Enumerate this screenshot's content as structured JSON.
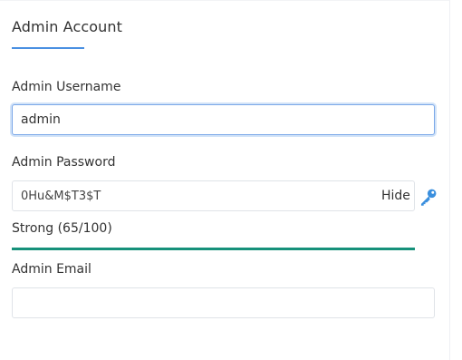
{
  "section": {
    "title": "Admin Account"
  },
  "username": {
    "label": "Admin Username",
    "value": "admin",
    "placeholder": ""
  },
  "password": {
    "label": "Admin Password",
    "value": "0Hu&M$T3$T",
    "toggle_label": "Hide",
    "generate_icon": "key-icon"
  },
  "strength": {
    "text": "Strong (65/100)",
    "level": 1.0,
    "color": "#16917a"
  },
  "email": {
    "label": "Admin Email",
    "value": "",
    "placeholder": ""
  },
  "colors": {
    "accent": "#4a90e2",
    "strength_bar": "#16917a"
  }
}
